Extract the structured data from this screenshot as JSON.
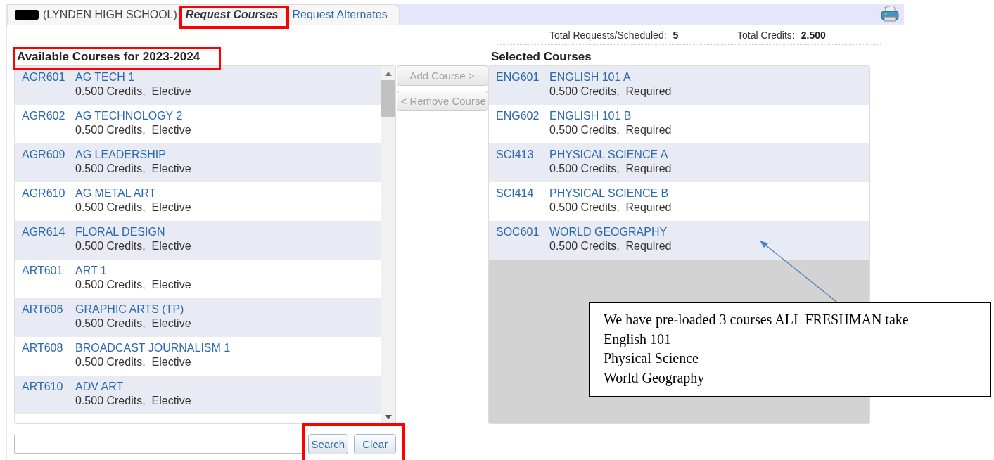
{
  "header": {
    "school": "(LYNDEN HIGH SCHOOL)",
    "tabs": [
      {
        "label": "Request Courses",
        "selected": true
      },
      {
        "label": "Request Alternates",
        "selected": false
      }
    ]
  },
  "totals": [
    {
      "label": "Total Requests/Scheduled:",
      "value": "5"
    },
    {
      "label": "Total Credits:",
      "value": "2.500"
    }
  ],
  "available": {
    "title": "Available Courses for 2023-2024",
    "courses": [
      {
        "code": "AGR601",
        "name": "AG TECH 1",
        "details": "0.500 Credits,  Elective"
      },
      {
        "code": "AGR602",
        "name": "AG TECHNOLOGY 2",
        "details": "0.500 Credits,  Elective"
      },
      {
        "code": "AGR609",
        "name": "AG LEADERSHIP",
        "details": "0.500 Credits,  Elective"
      },
      {
        "code": "AGR610",
        "name": "AG METAL ART",
        "details": "0.500 Credits,  Elective"
      },
      {
        "code": "AGR614",
        "name": "FLORAL DESIGN",
        "details": "0.500 Credits,  Elective"
      },
      {
        "code": "ART601",
        "name": "ART 1",
        "details": "0.500 Credits,  Elective"
      },
      {
        "code": "ART606",
        "name": "GRAPHIC ARTS (TP)",
        "details": "0.500 Credits,  Elective"
      },
      {
        "code": "ART608",
        "name": "BROADCAST JOURNALISM 1",
        "details": "0.500 Credits,  Elective"
      },
      {
        "code": "ART610",
        "name": "ADV ART",
        "details": "0.500 Credits,  Elective"
      }
    ]
  },
  "actions": [
    {
      "label": "Add Course >",
      "disabled": true
    },
    {
      "label": "< Remove Course",
      "disabled": true
    }
  ],
  "selected_courses": {
    "title": "Selected Courses",
    "courses": [
      {
        "code": "ENG601",
        "name": "ENGLISH 101 A",
        "details": "0.500 Credits,  Required"
      },
      {
        "code": "ENG602",
        "name": "ENGLISH 101 B",
        "details": "0.500 Credits,  Required"
      },
      {
        "code": "SCI413",
        "name": "PHYSICAL SCIENCE A",
        "details": "0.500 Credits,  Required"
      },
      {
        "code": "SCI414",
        "name": "PHYSICAL SCIENCE B",
        "details": "0.500 Credits,  Required"
      },
      {
        "code": "SOC601",
        "name": "WORLD GEOGRAPHY",
        "details": "0.500 Credits,  Required"
      }
    ]
  },
  "search": {
    "buttons": [
      "Search",
      "Clear"
    ]
  },
  "annotation": {
    "lines": [
      "We have pre-loaded 3 courses ALL FRESHMAN take",
      "English 101",
      "Physical Science",
      "World Geography"
    ]
  }
}
